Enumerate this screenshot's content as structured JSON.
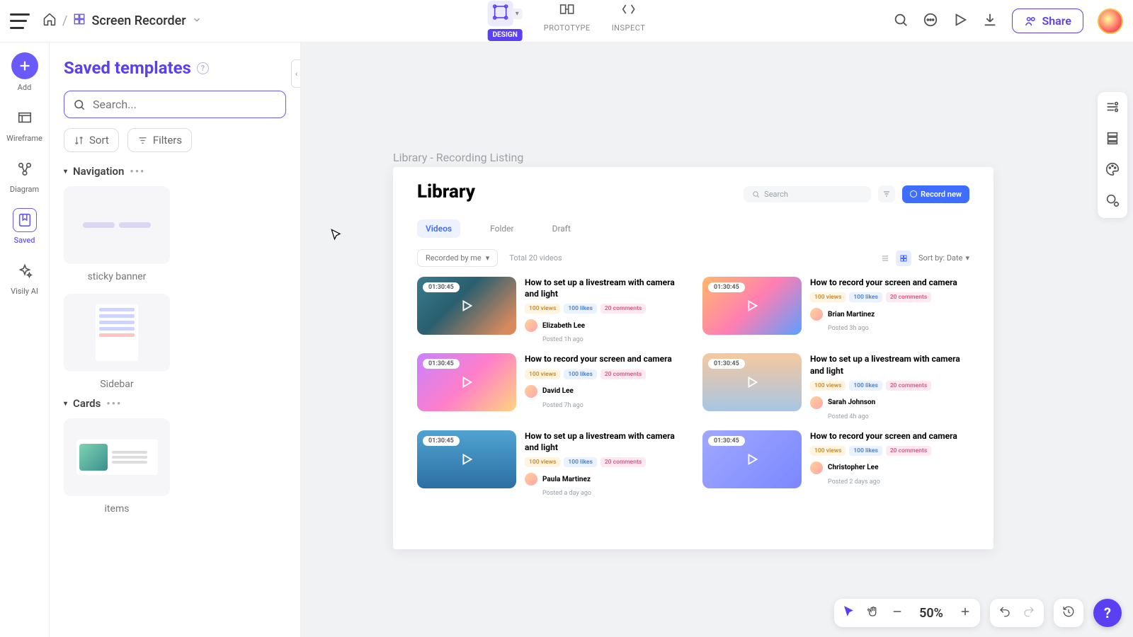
{
  "breadcrumb": {
    "doc_name": "Screen Recorder"
  },
  "modes": {
    "design": "DESIGN",
    "prototype": "PROTOTYPE",
    "inspect": "INSPECT"
  },
  "share_label": "Share",
  "rail": {
    "add": "Add",
    "wireframe": "Wireframe",
    "diagram": "Diagram",
    "saved": "Saved",
    "ai": "Visily AI"
  },
  "panel": {
    "title": "Saved templates",
    "search_placeholder": "Search...",
    "sort": "Sort",
    "filters": "Filters",
    "sections": {
      "navigation": "Navigation",
      "cards": "Cards"
    },
    "templates": {
      "sticky_banner": "sticky banner",
      "sidebar": "Sidebar",
      "items": "items"
    }
  },
  "frame_label": "Library - Recording Listing",
  "frame": {
    "title": "Library",
    "search_placeholder": "Search",
    "record_new": "Record new",
    "tabs": [
      "Videos",
      "Folder",
      "Draft"
    ],
    "recorded_by": "Recorded by me",
    "total": "Total 20 videos",
    "sort_by": "Sort by: Date"
  },
  "cards": [
    {
      "dur": "01:30:45",
      "title": "How to set up a livestream with camera and light",
      "views": "100 views",
      "likes": "100 likes",
      "comments": "20 comments",
      "author": "Elizabeth Lee",
      "posted": "Posted 1h ago",
      "g": "g0"
    },
    {
      "dur": "01:30:45",
      "title": "How to record your screen and camera",
      "views": "100 views",
      "likes": "100 likes",
      "comments": "20 comments",
      "author": "Brian Martinez",
      "posted": "Posted 3h ago",
      "g": "g1"
    },
    {
      "dur": "01:30:45",
      "title": "How to record your screen and camera",
      "views": "100 views",
      "likes": "100 likes",
      "comments": "20 comments",
      "author": "David Lee",
      "posted": "Posted 7h ago",
      "g": "g2"
    },
    {
      "dur": "01:30:45",
      "title": "How to set up a livestream with camera and light",
      "views": "100 views",
      "likes": "100 likes",
      "comments": "20 comments",
      "author": "Sarah Johnson",
      "posted": "Posted 4h ago",
      "g": "g3"
    },
    {
      "dur": "01:30:45",
      "title": "How to set up a livestream with camera and light",
      "views": "100 views",
      "likes": "100 likes",
      "comments": "20 comments",
      "author": "Paula Martinez",
      "posted": "Posted a day ago",
      "g": "g4"
    },
    {
      "dur": "01:30:45",
      "title": "How to record your screen and camera",
      "views": "100 views",
      "likes": "100 likes",
      "comments": "20 comments",
      "author": "Christopher Lee",
      "posted": "Posted 2 days ago",
      "g": "g5"
    }
  ],
  "zoom": "50%"
}
